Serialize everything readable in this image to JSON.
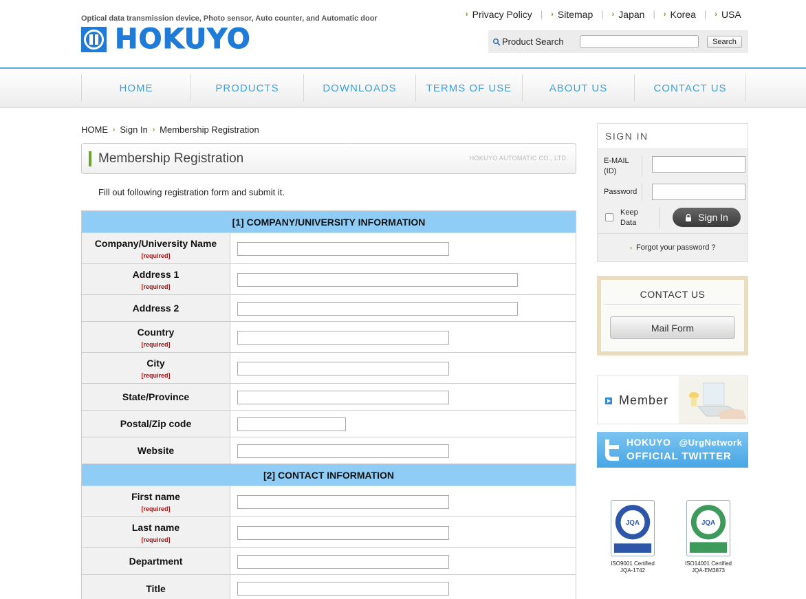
{
  "header": {
    "tagline": "Optical data transmission device, Photo sensor, Auto counter, and Automatic door",
    "logo_text": "HOKUYO",
    "top_links": [
      "Privacy Policy",
      "Sitemap",
      "Japan",
      "Korea",
      "USA"
    ],
    "search_label": "Product Search",
    "search_value": "",
    "search_button": "Search"
  },
  "nav": {
    "items": [
      "HOME",
      "PRODUCTS",
      "DOWNLOADS",
      "TERMS OF USE",
      "ABOUT US",
      "CONTACT US"
    ]
  },
  "breadcrumb": [
    "HOME",
    "Sign In",
    "Membership Registration"
  ],
  "page": {
    "title": "Membership Registration",
    "company": "HOKUYO AUTOMATIC CO., LTD.",
    "intro": "Fill out following registration form and submit it."
  },
  "form": {
    "required_tag": "[required]",
    "section1": "[1] COMPANY/UNIVERSITY INFORMATION",
    "section2": "[2] CONTACT INFORMATION",
    "fields": [
      {
        "label": "Company/University Name",
        "required": true,
        "value": ""
      },
      {
        "label": "Address 1",
        "required": true,
        "value": ""
      },
      {
        "label": "Address 2",
        "required": false,
        "value": ""
      },
      {
        "label": "Country",
        "required": true,
        "value": ""
      },
      {
        "label": "City",
        "required": true,
        "value": ""
      },
      {
        "label": "State/Province",
        "required": false,
        "value": ""
      },
      {
        "label": "Postal/Zip code",
        "required": false,
        "value": ""
      },
      {
        "label": "Website",
        "required": false,
        "value": ""
      },
      {
        "label": "First name",
        "required": true,
        "value": ""
      },
      {
        "label": "Last name",
        "required": true,
        "value": ""
      },
      {
        "label": "Department",
        "required": false,
        "value": ""
      },
      {
        "label": "Title",
        "required": false,
        "value": ""
      }
    ]
  },
  "signin": {
    "title": "SIGN IN",
    "email_label": "E-MAIL (ID)",
    "password_label": "Password",
    "keep_label": "Keep Data",
    "keep_checked": false,
    "button": "Sign In",
    "forgot": "Forgot your password ?"
  },
  "contact": {
    "title": "CONTACT US",
    "button": "Mail Form"
  },
  "member": {
    "label": "Member"
  },
  "twitter": {
    "brand": "HOKUYO",
    "handle": "@UrgNetwork",
    "tagline": "OFFICIAL TWITTER"
  },
  "certs": [
    {
      "badge_text": "QUALITY SYSTEM",
      "caption1": "ISO9001 Certified",
      "caption2": "JQA-1742",
      "color": "#2d55a8"
    },
    {
      "badge_text": "ENVIRONMENTAL SYSTEM",
      "caption1": "ISO14001 Certified",
      "caption2": "JQA-EM3873",
      "color": "#3d9a5a"
    }
  ],
  "colors": {
    "brand_blue": "#1f7bd8",
    "nav_text": "#3ca0dc",
    "section_bg": "#8fcdf7",
    "accent_green": "#6aa42d",
    "required_red": "#aa1111"
  }
}
